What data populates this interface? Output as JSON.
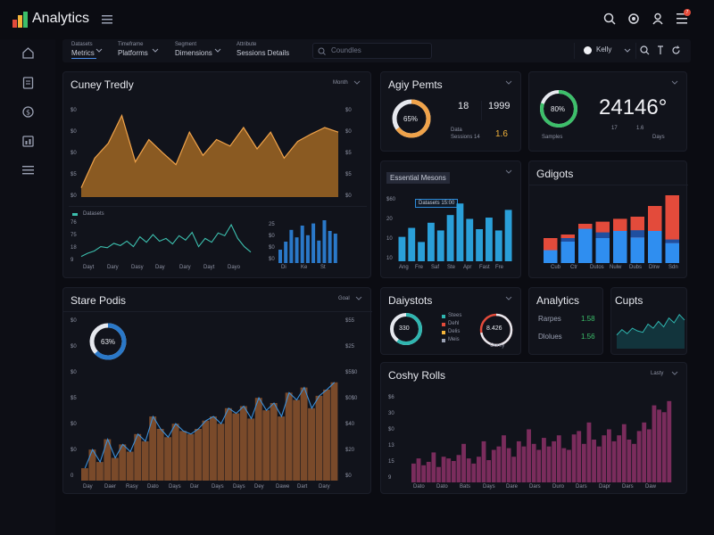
{
  "topbar": {
    "app_title": "Analytics",
    "icons": [
      "search-icon",
      "settings-icon",
      "user-icon",
      "notifications-icon"
    ],
    "badge": "7"
  },
  "sidebar": {
    "items": [
      "home-icon",
      "document-icon",
      "currency-icon",
      "reports-icon",
      "menu-icon"
    ]
  },
  "filters": {
    "items": [
      {
        "top": "Datasets",
        "value": "Metrics"
      },
      {
        "top": "Timeframe",
        "value": "Platforms"
      },
      {
        "top": "Segment",
        "value": "Dimensions"
      },
      {
        "top": "Attribute",
        "value": "Sessions Details"
      }
    ],
    "search_placeholder": "Coundles",
    "user_name": "Kelly"
  },
  "cards": {
    "currency_trends": {
      "title": "Cuney Tredly",
      "dropdown": "Month",
      "chart_area": {
        "y_left": [
          "$0",
          "$0",
          "$0",
          "$5",
          "$0"
        ],
        "y_right": [
          "$0",
          "$0",
          "$5",
          "$5",
          "$0"
        ],
        "values": [
          10,
          42,
          58,
          88,
          38,
          62,
          48,
          35,
          70,
          45,
          62,
          55,
          75,
          52,
          70,
          42,
          60,
          68,
          75,
          70
        ]
      },
      "legend": "Datasets",
      "chart_line": {
        "y_labels": [
          "76",
          "75",
          "18",
          "9"
        ],
        "x_labels": [
          "Dayt",
          "Dary",
          "Dasy",
          "Day",
          "Dary",
          "Dayt",
          "Dayo"
        ],
        "values": [
          12,
          18,
          22,
          30,
          28,
          36,
          32,
          40,
          30,
          48,
          38,
          52,
          40,
          45,
          35,
          50,
          42,
          56,
          30,
          45,
          38,
          55,
          50,
          70,
          45,
          30,
          20
        ]
      },
      "chart_bars": {
        "y_labels": [
          "25",
          "$0",
          "$0",
          "$0"
        ],
        "x_labels": [
          "Di",
          "Ke",
          "St"
        ],
        "values": [
          25,
          40,
          62,
          48,
          70,
          52,
          74,
          42,
          80,
          60,
          55
        ]
      }
    },
    "agile_points": {
      "title": "Agiy Pemts",
      "donut_label": "65%",
      "donut_value": 65,
      "stat_1": "18",
      "stat_2": "1999",
      "stat_3": "1.6",
      "foot_1": "Data",
      "foot_2": "Sessions 14"
    },
    "big_stat": {
      "value": "24146°",
      "donut_label": "80%",
      "donut_value": 80,
      "caption": "Samples",
      "sub_labels": [
        "17",
        "1.6",
        "Days"
      ]
    },
    "revenue_bars": {
      "title": "Essential Mesons",
      "tooltip": "Datasets 15:00",
      "y_labels": [
        "$60",
        "20",
        "10",
        "10"
      ],
      "x_labels": [
        "Ang",
        "Fre",
        "Saf",
        "Ste",
        "Apr",
        "Fast",
        "Fre"
      ],
      "values": [
        38,
        52,
        30,
        60,
        48,
        72,
        90,
        66,
        50,
        68,
        48,
        80
      ]
    },
    "gadgets": {
      "title": "Gdigots",
      "x_labels": [
        "Cub",
        "Ctr",
        "Dutos",
        "Nulw",
        "Dubs",
        "Dlrw",
        "Sdn"
      ],
      "series_red": [
        35,
        40,
        55,
        58,
        62,
        65,
        80,
        95
      ],
      "series_blue": [
        18,
        30,
        48,
        35,
        45,
        36,
        45,
        28
      ],
      "series_navy": [
        0,
        5,
        0,
        8,
        0,
        10,
        0,
        5
      ],
      "colors": {
        "red": "#e34b3b",
        "blue": "#2f8ef0",
        "navy": "#1f4fa0"
      }
    },
    "stage_pools": {
      "title": "Stare Podis",
      "dropdown": "Goal",
      "donut_label": "63%",
      "donut_value": 63,
      "y_left": [
        "$0",
        "$0",
        "$0",
        "$5",
        "$0",
        "$0",
        "0"
      ],
      "y_right": [
        "$55",
        "$25",
        "$5$0",
        "$0$0",
        "$40",
        "$20",
        "$0"
      ],
      "x_labels": [
        "Day",
        "Daer",
        "Rasy",
        "Dato",
        "Days",
        "Dar",
        "Days",
        "Days",
        "Dey",
        "Dawe",
        "Dart",
        "Dary"
      ],
      "values": [
        12,
        30,
        18,
        40,
        22,
        35,
        28,
        45,
        38,
        62,
        50,
        42,
        55,
        48,
        45,
        50,
        58,
        62,
        55,
        70,
        65,
        72,
        60,
        80,
        68,
        75,
        62,
        85,
        78,
        90,
        70,
        82,
        88,
        95
      ]
    },
    "day_stats": {
      "title": "Daiystots",
      "donut_1_label": "330",
      "donut_1_value": 60,
      "legend": [
        "Stees",
        "Dehl",
        "Delis",
        "Meis"
      ],
      "donut_2_label": "8.426",
      "donut_2_value": 72,
      "donut_2_sub": "Ourey"
    },
    "analytics_small": {
      "title": "Analytics",
      "rows": [
        {
          "label": "Rarpes",
          "value": "1.58"
        },
        {
          "label": "Dlolues",
          "value": "1.56"
        }
      ]
    },
    "cupts": {
      "title": "Cupts",
      "values": [
        20,
        28,
        22,
        30,
        26,
        24,
        36,
        30,
        40,
        32,
        45,
        38,
        50,
        42
      ]
    },
    "costly_fields": {
      "title": "Coshy Rolls",
      "dropdown": "Lasty",
      "y_labels": [
        "$6",
        "30",
        "$0",
        "13",
        "15",
        "9"
      ],
      "x_labels": [
        "Dato",
        "Dato",
        "Bats",
        "Days",
        "Dare",
        "Dars",
        "Duro",
        "Dars",
        "Dapr",
        "Dars",
        "Daw"
      ],
      "values": [
        22,
        28,
        20,
        24,
        35,
        18,
        30,
        28,
        25,
        32,
        45,
        28,
        22,
        30,
        48,
        26,
        38,
        42,
        55,
        40,
        30,
        48,
        42,
        62,
        45,
        38,
        52,
        42,
        48,
        55,
        40,
        38,
        56,
        60,
        45,
        70,
        50,
        42,
        55,
        62,
        48,
        55,
        68,
        50,
        45,
        60,
        70,
        62,
        90,
        85,
        82,
        95
      ]
    }
  }
}
